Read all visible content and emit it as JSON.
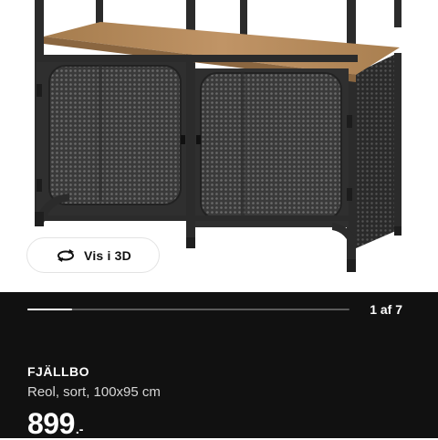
{
  "gallery": {
    "view_3d_label": "Vis i 3D",
    "page_counter": "1 af 7",
    "current_index": 1,
    "total_images": 7,
    "progress_fraction": 0.14
  },
  "product": {
    "name": "FJÄLLBO",
    "description": "Reol, sort, 100x95 cm",
    "price": "899",
    "price_suffix": ".-"
  },
  "icons": {
    "view_3d": "rotate-3d-icon"
  },
  "colors": {
    "panel_background": "#111111",
    "text_primary": "#ffffff",
    "text_secondary": "#d6d6d6",
    "shelf_wood": "#b48a58",
    "frame_metal": "#2b2b2b"
  }
}
